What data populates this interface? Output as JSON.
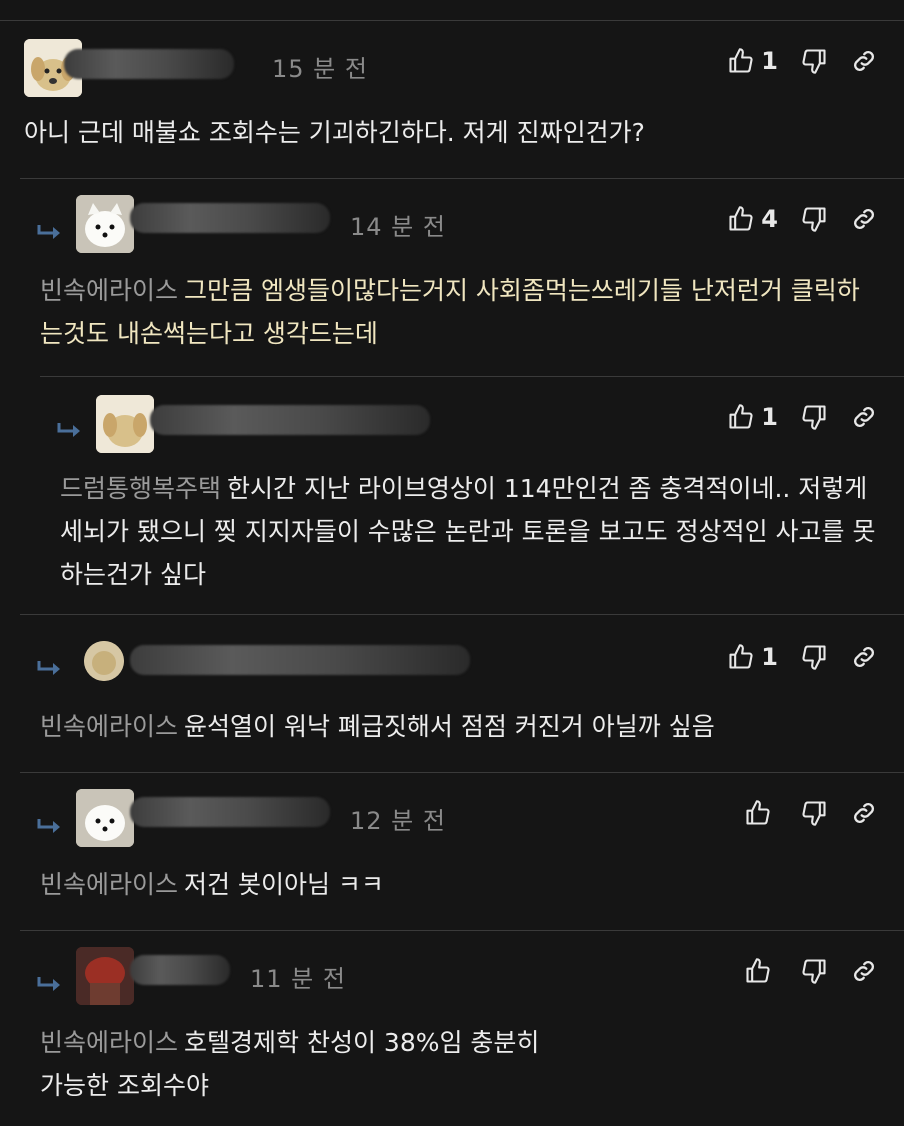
{
  "comments": [
    {
      "time": "15 분 전",
      "likes": "1",
      "mention": "",
      "text": "아니 근데 매불쇼 조회수는 기괴하긴하다. 저게 진짜인건가?"
    },
    {
      "time": "14 분 전",
      "likes": "4",
      "mention": "빈속에라이스",
      "text": "그만큼 엠생들이많다는거지 사회좀먹는쓰레기들 난저런거 클릭하는것도 내손썩는다고 생각드는데"
    },
    {
      "time": "",
      "likes": "1",
      "mention": "드럼통행복주택",
      "text": "한시간 지난 라이브영상이 114만인건 좀 충격적이네.. 저렇게 세뇌가 됐으니 찢 지지자들이 수많은 논란과 토론을 보고도 정상적인 사고를 못하는건가 싶다"
    },
    {
      "time": "",
      "likes": "1",
      "mention": "빈속에라이스",
      "text": "윤석열이 워낙 폐급짓해서 점점 커진거 아닐까 싶음"
    },
    {
      "time": "12 분 전",
      "likes": "",
      "mention": "빈속에라이스",
      "text": "저건 봇이아님 ㅋㅋ"
    },
    {
      "time": "11 분 전",
      "likes": "",
      "mention": "빈속에라이스",
      "text": "호텔경제학 찬성이 38%임 충분히 가능한 조회수야"
    }
  ],
  "icons": {
    "like": "thumbs-up-icon",
    "dislike": "thumbs-down-icon",
    "link": "link-icon",
    "reply": "reply-arrow-icon"
  },
  "colors": {
    "background": "#151515",
    "text": "#ececec",
    "muted": "#8a8a8a",
    "highlight": "#f0e6c0",
    "divider": "#3a3a3a"
  }
}
